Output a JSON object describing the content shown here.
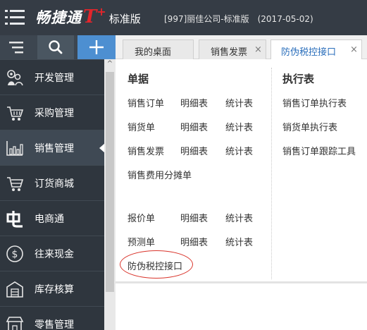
{
  "header": {
    "brand_name": "畅捷通",
    "brand_logo": "T",
    "brand_plus": "+",
    "edition": "标准版",
    "company": "[997]丽佳公司-标准版",
    "date": "(2017-05-02)"
  },
  "toolbar": {
    "menu_icon": "list-menu-icon",
    "search_icon": "search-icon",
    "add_icon": "plus-icon"
  },
  "sidebar": {
    "items": [
      {
        "label": "开发管理",
        "icon": "gears-person-icon"
      },
      {
        "label": "采购管理",
        "icon": "shopping-cart-icon"
      },
      {
        "label": "销售管理",
        "icon": "bar-chart-icon",
        "active": true
      },
      {
        "label": "订货商城",
        "icon": "cart-icon"
      },
      {
        "label": "电商通",
        "icon": "dian-logo-icon"
      },
      {
        "label": "往来现金",
        "icon": "dollar-circle-icon"
      },
      {
        "label": "库存核算",
        "icon": "warehouse-icon"
      },
      {
        "label": "零售管理",
        "icon": "store-icon"
      }
    ]
  },
  "tabs": [
    {
      "label": "我的桌面",
      "closable": false
    },
    {
      "label": "销售发票",
      "closable": true
    },
    {
      "label": "防伪税控接口",
      "closable": true,
      "active": true
    }
  ],
  "close_glyph": "×",
  "scroll_up_glyph": "^",
  "menu": {
    "documents": {
      "title": "单据",
      "rows": [
        [
          "销售订单",
          "明细表",
          "统计表"
        ],
        [
          "销货单",
          "明细表",
          "统计表"
        ],
        [
          "销售发票",
          "明细表",
          "统计表"
        ],
        [
          "销售费用分摊单"
        ],
        [
          "报价单",
          "明细表",
          "统计表"
        ],
        [
          "预测单",
          "明细表",
          "统计表"
        ],
        [
          "防伪税控接口"
        ]
      ]
    },
    "execution": {
      "title": "执行表",
      "items": [
        "销售订单执行表",
        "销货单执行表",
        "销售订单跟踪工具"
      ]
    }
  },
  "colors": {
    "topbar": "#353c45",
    "sidebar": "#2f363e",
    "accent_blue": "#4d8fd1",
    "brand_red": "#e2252b",
    "highlight_red": "#d9342b"
  }
}
